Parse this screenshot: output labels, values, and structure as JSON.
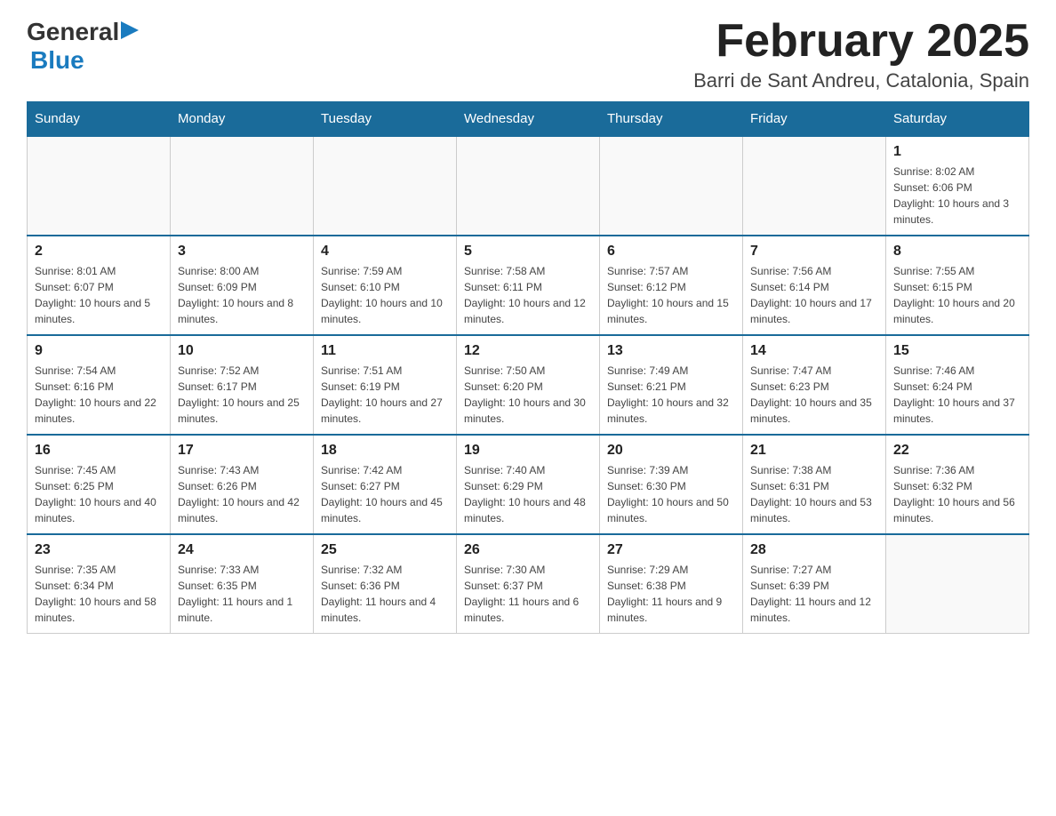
{
  "header": {
    "logo_general": "General",
    "logo_blue": "Blue",
    "month_title": "February 2025",
    "location": "Barri de Sant Andreu, Catalonia, Spain"
  },
  "days_of_week": [
    "Sunday",
    "Monday",
    "Tuesday",
    "Wednesday",
    "Thursday",
    "Friday",
    "Saturday"
  ],
  "weeks": [
    [
      {
        "day": "",
        "info": ""
      },
      {
        "day": "",
        "info": ""
      },
      {
        "day": "",
        "info": ""
      },
      {
        "day": "",
        "info": ""
      },
      {
        "day": "",
        "info": ""
      },
      {
        "day": "",
        "info": ""
      },
      {
        "day": "1",
        "info": "Sunrise: 8:02 AM\nSunset: 6:06 PM\nDaylight: 10 hours and 3 minutes."
      }
    ],
    [
      {
        "day": "2",
        "info": "Sunrise: 8:01 AM\nSunset: 6:07 PM\nDaylight: 10 hours and 5 minutes."
      },
      {
        "day": "3",
        "info": "Sunrise: 8:00 AM\nSunset: 6:09 PM\nDaylight: 10 hours and 8 minutes."
      },
      {
        "day": "4",
        "info": "Sunrise: 7:59 AM\nSunset: 6:10 PM\nDaylight: 10 hours and 10 minutes."
      },
      {
        "day": "5",
        "info": "Sunrise: 7:58 AM\nSunset: 6:11 PM\nDaylight: 10 hours and 12 minutes."
      },
      {
        "day": "6",
        "info": "Sunrise: 7:57 AM\nSunset: 6:12 PM\nDaylight: 10 hours and 15 minutes."
      },
      {
        "day": "7",
        "info": "Sunrise: 7:56 AM\nSunset: 6:14 PM\nDaylight: 10 hours and 17 minutes."
      },
      {
        "day": "8",
        "info": "Sunrise: 7:55 AM\nSunset: 6:15 PM\nDaylight: 10 hours and 20 minutes."
      }
    ],
    [
      {
        "day": "9",
        "info": "Sunrise: 7:54 AM\nSunset: 6:16 PM\nDaylight: 10 hours and 22 minutes."
      },
      {
        "day": "10",
        "info": "Sunrise: 7:52 AM\nSunset: 6:17 PM\nDaylight: 10 hours and 25 minutes."
      },
      {
        "day": "11",
        "info": "Sunrise: 7:51 AM\nSunset: 6:19 PM\nDaylight: 10 hours and 27 minutes."
      },
      {
        "day": "12",
        "info": "Sunrise: 7:50 AM\nSunset: 6:20 PM\nDaylight: 10 hours and 30 minutes."
      },
      {
        "day": "13",
        "info": "Sunrise: 7:49 AM\nSunset: 6:21 PM\nDaylight: 10 hours and 32 minutes."
      },
      {
        "day": "14",
        "info": "Sunrise: 7:47 AM\nSunset: 6:23 PM\nDaylight: 10 hours and 35 minutes."
      },
      {
        "day": "15",
        "info": "Sunrise: 7:46 AM\nSunset: 6:24 PM\nDaylight: 10 hours and 37 minutes."
      }
    ],
    [
      {
        "day": "16",
        "info": "Sunrise: 7:45 AM\nSunset: 6:25 PM\nDaylight: 10 hours and 40 minutes."
      },
      {
        "day": "17",
        "info": "Sunrise: 7:43 AM\nSunset: 6:26 PM\nDaylight: 10 hours and 42 minutes."
      },
      {
        "day": "18",
        "info": "Sunrise: 7:42 AM\nSunset: 6:27 PM\nDaylight: 10 hours and 45 minutes."
      },
      {
        "day": "19",
        "info": "Sunrise: 7:40 AM\nSunset: 6:29 PM\nDaylight: 10 hours and 48 minutes."
      },
      {
        "day": "20",
        "info": "Sunrise: 7:39 AM\nSunset: 6:30 PM\nDaylight: 10 hours and 50 minutes."
      },
      {
        "day": "21",
        "info": "Sunrise: 7:38 AM\nSunset: 6:31 PM\nDaylight: 10 hours and 53 minutes."
      },
      {
        "day": "22",
        "info": "Sunrise: 7:36 AM\nSunset: 6:32 PM\nDaylight: 10 hours and 56 minutes."
      }
    ],
    [
      {
        "day": "23",
        "info": "Sunrise: 7:35 AM\nSunset: 6:34 PM\nDaylight: 10 hours and 58 minutes."
      },
      {
        "day": "24",
        "info": "Sunrise: 7:33 AM\nSunset: 6:35 PM\nDaylight: 11 hours and 1 minute."
      },
      {
        "day": "25",
        "info": "Sunrise: 7:32 AM\nSunset: 6:36 PM\nDaylight: 11 hours and 4 minutes."
      },
      {
        "day": "26",
        "info": "Sunrise: 7:30 AM\nSunset: 6:37 PM\nDaylight: 11 hours and 6 minutes."
      },
      {
        "day": "27",
        "info": "Sunrise: 7:29 AM\nSunset: 6:38 PM\nDaylight: 11 hours and 9 minutes."
      },
      {
        "day": "28",
        "info": "Sunrise: 7:27 AM\nSunset: 6:39 PM\nDaylight: 11 hours and 12 minutes."
      },
      {
        "day": "",
        "info": ""
      }
    ]
  ]
}
